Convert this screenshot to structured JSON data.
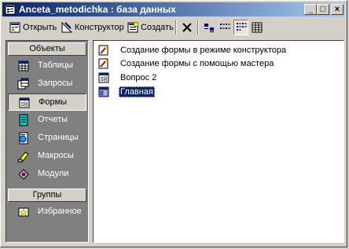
{
  "window": {
    "title": "Anceta_metodichka : база данных"
  },
  "titlebar_buttons": {
    "minimize": "_",
    "maximize": "□",
    "close": "×"
  },
  "toolbar": {
    "open": "Открыть",
    "design": "Конструктор",
    "create": "Создать"
  },
  "sidebar": {
    "objects_header": "Объекты",
    "items": [
      {
        "label": "Таблицы",
        "icon": "table-icon"
      },
      {
        "label": "Запросы",
        "icon": "query-icon"
      },
      {
        "label": "Формы",
        "icon": "form-icon"
      },
      {
        "label": "Отчеты",
        "icon": "report-icon"
      },
      {
        "label": "Страницы",
        "icon": "page-icon"
      },
      {
        "label": "Макросы",
        "icon": "macro-icon"
      },
      {
        "label": "Модули",
        "icon": "module-icon"
      }
    ],
    "selected_index": 2,
    "groups_header": "Группы",
    "groups": [
      {
        "label": "Избранное",
        "icon": "favorites-icon"
      }
    ]
  },
  "list": {
    "items": [
      {
        "label": "Создание формы в режиме конструктора",
        "icon": "wizard-icon"
      },
      {
        "label": "Создание формы с помощью мастера",
        "icon": "wizard-icon"
      },
      {
        "label": "Вопрос 2",
        "icon": "form-icon"
      },
      {
        "label": "Главная",
        "icon": "form-icon"
      }
    ],
    "selected_index": 3
  },
  "colors": {
    "title_start": "#0a246a",
    "title_end": "#a6caf0",
    "sidebar_bg": "#808080",
    "face": "#d4d0c8"
  }
}
